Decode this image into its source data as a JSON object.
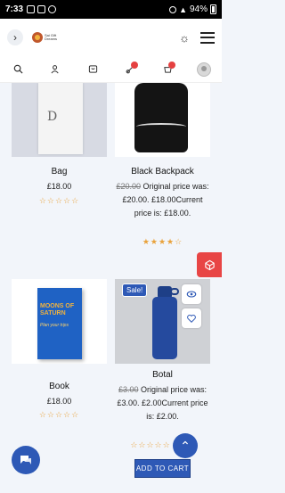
{
  "status": {
    "time": "7:33",
    "battery": "94%"
  },
  "header": {
    "logo_text": "Sai Gift Dreams"
  },
  "products": [
    {
      "name": "Bag",
      "price": "£18.00",
      "rating_stars": "☆☆☆☆☆"
    },
    {
      "name": "Black Backpack",
      "original_price": "£20.00",
      "original_label": "Original price was: £20.00.",
      "current_price": "£18.00",
      "current_label": "Current price is: £18.00.",
      "rating_stars": "★★★★☆"
    },
    {
      "name": "Book",
      "price": "£18.00",
      "rating_stars": "☆☆☆☆☆",
      "book_title": "MOONS OF SATURN",
      "book_subtitle": "Plan your trips"
    },
    {
      "name": "Botal",
      "original_price": "£3.00",
      "original_label": "Original price was: £3.00.",
      "current_price": "£2.00",
      "current_label": "Current price is: £2.00.",
      "rating_stars": "☆☆☆☆☆",
      "badge": "Sale!"
    }
  ],
  "buttons": {
    "add_to_cart": "ADD TO CART"
  },
  "bag_logo": "D",
  "colors": {
    "primary": "#2e59b6",
    "accent": "#e84545",
    "star": "#e9a23b"
  }
}
